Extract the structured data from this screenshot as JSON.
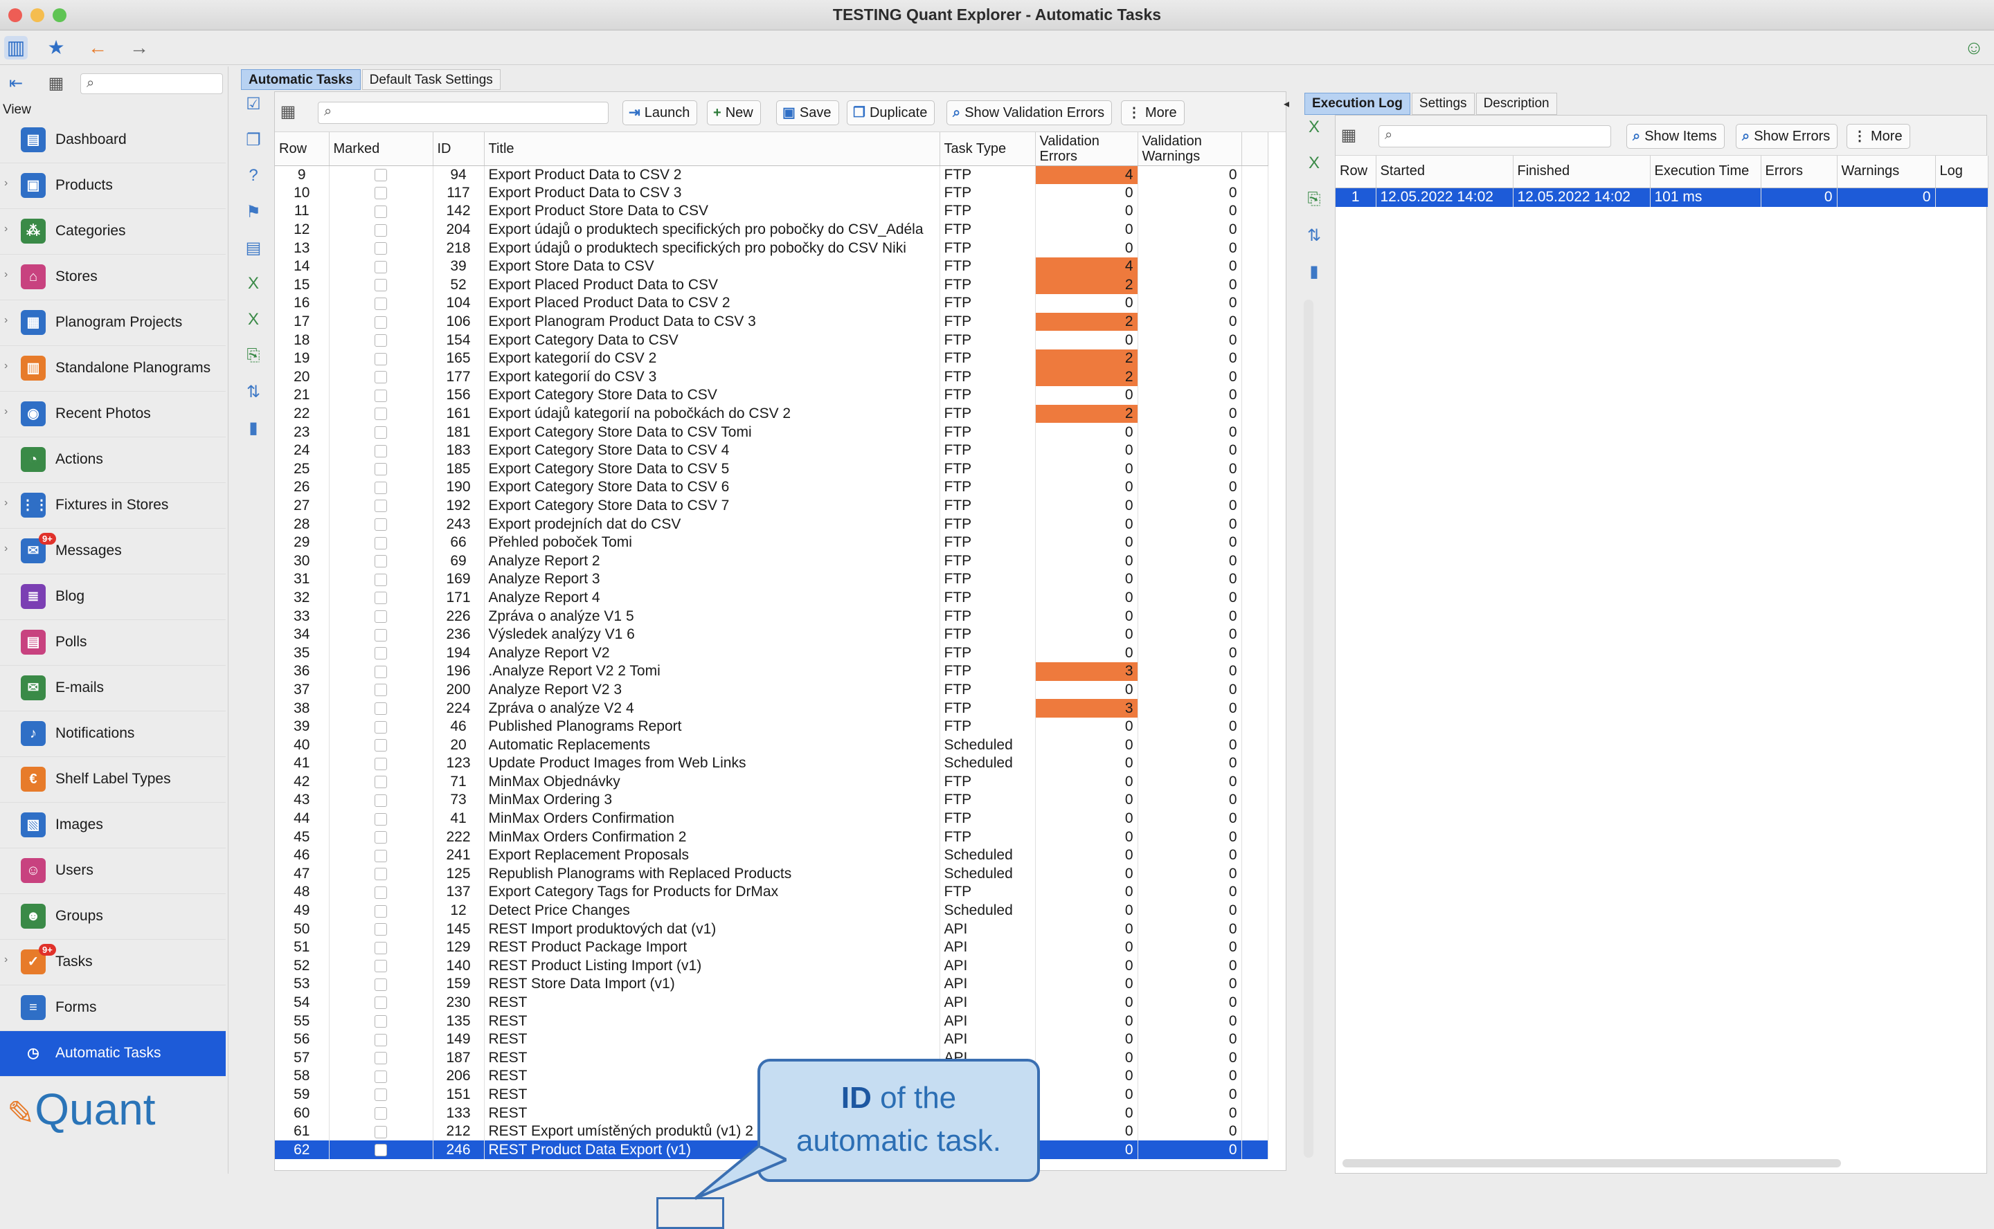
{
  "window": {
    "title": "TESTING Quant Explorer - Automatic Tasks"
  },
  "sidebar": {
    "view_label": "View",
    "items": [
      {
        "label": "Dashboard",
        "icon": "dashboard-icon",
        "color": "#2f6fc6",
        "chevron": false
      },
      {
        "label": "Products",
        "icon": "products-icon",
        "color": "#2f6fc6",
        "chevron": true
      },
      {
        "label": "Categories",
        "icon": "categories-icon",
        "color": "#3a8a47",
        "chevron": true
      },
      {
        "label": "Stores",
        "icon": "stores-icon",
        "color": "#c8427f",
        "chevron": true
      },
      {
        "label": "Planogram Projects",
        "icon": "planogram-projects-icon",
        "color": "#2f6fc6",
        "chevron": true
      },
      {
        "label": "Standalone Planograms",
        "icon": "standalone-planograms-icon",
        "color": "#e77b2a",
        "chevron": true
      },
      {
        "label": "Recent Photos",
        "icon": "camera-icon",
        "color": "#2f6fc6",
        "chevron": true
      },
      {
        "label": "Actions",
        "icon": "actions-icon",
        "color": "#3a8a47",
        "chevron": false
      },
      {
        "label": "Fixtures in Stores",
        "icon": "fixtures-icon",
        "color": "#2f6fc6",
        "chevron": true
      },
      {
        "label": "Messages",
        "icon": "messages-icon",
        "color": "#2f6fc6",
        "chevron": true,
        "badge": "9+"
      },
      {
        "label": "Blog",
        "icon": "blog-icon",
        "color": "#7b3fb3",
        "chevron": false
      },
      {
        "label": "Polls",
        "icon": "polls-icon",
        "color": "#c8427f",
        "chevron": false
      },
      {
        "label": "E-mails",
        "icon": "email-icon",
        "color": "#3a8a47",
        "chevron": false
      },
      {
        "label": "Notifications",
        "icon": "notifications-icon",
        "color": "#2f6fc6",
        "chevron": false
      },
      {
        "label": "Shelf Label Types",
        "icon": "shelf-label-icon",
        "color": "#e77b2a",
        "chevron": false
      },
      {
        "label": "Images",
        "icon": "images-icon",
        "color": "#2f6fc6",
        "chevron": false
      },
      {
        "label": "Users",
        "icon": "users-icon",
        "color": "#c8427f",
        "chevron": false
      },
      {
        "label": "Groups",
        "icon": "groups-icon",
        "color": "#3a8a47",
        "chevron": false
      },
      {
        "label": "Tasks",
        "icon": "tasks-icon",
        "color": "#e77b2a",
        "chevron": true,
        "badge": "9+"
      },
      {
        "label": "Forms",
        "icon": "forms-icon",
        "color": "#2f6fc6",
        "chevron": false
      },
      {
        "label": "Automatic Tasks",
        "icon": "automatic-tasks-icon",
        "color": "#2f6fc6",
        "chevron": false,
        "selected": true
      }
    ],
    "logo": "Quant"
  },
  "main": {
    "tabs": [
      "Automatic Tasks",
      "Default Task Settings"
    ],
    "buttons": {
      "launch": "Launch",
      "new": "New",
      "save": "Save",
      "duplicate": "Duplicate",
      "show_validation_errors": "Show Validation Errors",
      "more": "More"
    },
    "columns": [
      "Row",
      "Marked",
      "ID",
      "Title",
      "Task Type",
      "Validation Errors",
      "Validation Warnings"
    ],
    "rows": [
      [
        9,
        94,
        "Export Product Data to CSV 2",
        "FTP",
        4,
        0
      ],
      [
        10,
        117,
        "Export Product Data to CSV 3",
        "FTP",
        0,
        0
      ],
      [
        11,
        142,
        "Export Product Store Data to CSV",
        "FTP",
        0,
        0
      ],
      [
        12,
        204,
        "Export údajů o produktech specifických pro pobočky do CSV_Adéla",
        "FTP",
        0,
        0
      ],
      [
        13,
        218,
        "Export údajů o produktech specifických pro pobočky do CSV Niki",
        "FTP",
        0,
        0
      ],
      [
        14,
        39,
        "Export Store Data to CSV",
        "FTP",
        4,
        0
      ],
      [
        15,
        52,
        "Export Placed Product Data to CSV",
        "FTP",
        2,
        0
      ],
      [
        16,
        104,
        "Export Placed Product Data to CSV 2",
        "FTP",
        0,
        0
      ],
      [
        17,
        106,
        "Export Planogram Product Data to CSV 3",
        "FTP",
        2,
        0
      ],
      [
        18,
        154,
        "Export Category Data to CSV",
        "FTP",
        0,
        0
      ],
      [
        19,
        165,
        "Export kategorií do CSV 2",
        "FTP",
        2,
        0
      ],
      [
        20,
        177,
        "Export kategorií do CSV 3",
        "FTP",
        2,
        0
      ],
      [
        21,
        156,
        "Export Category Store Data to CSV",
        "FTP",
        0,
        0
      ],
      [
        22,
        161,
        "Export údajů kategorií na pobočkách do CSV 2",
        "FTP",
        2,
        0
      ],
      [
        23,
        181,
        "Export Category Store Data to CSV Tomi",
        "FTP",
        0,
        0
      ],
      [
        24,
        183,
        "Export Category Store Data to CSV 4",
        "FTP",
        0,
        0
      ],
      [
        25,
        185,
        "Export Category Store Data to CSV 5",
        "FTP",
        0,
        0
      ],
      [
        26,
        190,
        "Export Category Store Data to CSV 6",
        "FTP",
        0,
        0
      ],
      [
        27,
        192,
        "Export Category Store Data to CSV 7",
        "FTP",
        0,
        0
      ],
      [
        28,
        243,
        "Export prodejních dat do CSV",
        "FTP",
        0,
        0
      ],
      [
        29,
        66,
        "Přehled poboček Tomi",
        "FTP",
        0,
        0
      ],
      [
        30,
        69,
        "Analyze Report 2",
        "FTP",
        0,
        0
      ],
      [
        31,
        169,
        "Analyze Report 3",
        "FTP",
        0,
        0
      ],
      [
        32,
        171,
        "Analyze Report 4",
        "FTP",
        0,
        0
      ],
      [
        33,
        226,
        "Zpráva o analýze V1 5",
        "FTP",
        0,
        0
      ],
      [
        34,
        236,
        "Výsledek analýzy V1 6",
        "FTP",
        0,
        0
      ],
      [
        35,
        194,
        "Analyze Report V2",
        "FTP",
        0,
        0
      ],
      [
        36,
        196,
        ".Analyze Report V2 2 Tomi",
        "FTP",
        3,
        0
      ],
      [
        37,
        200,
        "Analyze Report V2 3",
        "FTP",
        0,
        0
      ],
      [
        38,
        224,
        "Zpráva o analýze V2 4",
        "FTP",
        3,
        0
      ],
      [
        39,
        46,
        "Published Planograms Report",
        "FTP",
        0,
        0
      ],
      [
        40,
        20,
        "Automatic Replacements",
        "Scheduled",
        0,
        0
      ],
      [
        41,
        123,
        "Update Product Images from Web Links",
        "Scheduled",
        0,
        0
      ],
      [
        42,
        71,
        "MinMax Objednávky",
        "FTP",
        0,
        0
      ],
      [
        43,
        73,
        "MinMax Ordering 3",
        "FTP",
        0,
        0
      ],
      [
        44,
        41,
        "MinMax Orders Confirmation",
        "FTP",
        0,
        0
      ],
      [
        45,
        222,
        "MinMax Orders Confirmation 2",
        "FTP",
        0,
        0
      ],
      [
        46,
        241,
        "Export Replacement Proposals",
        "Scheduled",
        0,
        0
      ],
      [
        47,
        125,
        "Republish Planograms with Replaced Products",
        "Scheduled",
        0,
        0
      ],
      [
        48,
        137,
        "Export Category Tags for Products for DrMax",
        "FTP",
        0,
        0
      ],
      [
        49,
        12,
        "Detect Price Changes",
        "Scheduled",
        0,
        0
      ],
      [
        50,
        145,
        "REST Import produktových dat (v1)",
        "API",
        0,
        0
      ],
      [
        51,
        129,
        "REST Product Package Import",
        "API",
        0,
        0
      ],
      [
        52,
        140,
        "REST Product Listing Import (v1)",
        "API",
        0,
        0
      ],
      [
        53,
        159,
        "REST Store Data Import (v1)",
        "API",
        0,
        0
      ],
      [
        54,
        230,
        "REST",
        "API",
        0,
        0
      ],
      [
        55,
        135,
        "REST",
        "API",
        0,
        0
      ],
      [
        56,
        149,
        "REST",
        "API",
        0,
        0
      ],
      [
        57,
        187,
        "REST",
        "API",
        0,
        0
      ],
      [
        58,
        206,
        "REST",
        "API",
        0,
        0
      ],
      [
        59,
        151,
        "REST",
        "API",
        0,
        0
      ],
      [
        60,
        133,
        "REST",
        "API",
        0,
        0
      ],
      [
        61,
        212,
        "REST Export umístěných produktů (v1) 2",
        "API",
        0,
        0
      ],
      [
        62,
        246,
        "REST Product Data Export (v1)",
        "API",
        0,
        0
      ]
    ],
    "selected_row": 62,
    "callout": {
      "bold": "ID",
      "rest1": " of the",
      "line2": "automatic task."
    }
  },
  "right": {
    "tabs": [
      "Execution Log",
      "Settings",
      "Description"
    ],
    "buttons": {
      "show_items": "Show Items",
      "show_errors": "Show Errors",
      "more": "More"
    },
    "columns": [
      "Row",
      "Started",
      "Finished",
      "Execution Time",
      "Errors",
      "Warnings",
      "Log"
    ],
    "rows": [
      [
        "1",
        "12.05.2022 14:02",
        "12.05.2022 14:02",
        "101 ms",
        "0",
        "0",
        ""
      ]
    ]
  },
  "colors": {
    "selection": "#1d5bd8",
    "error_cell": "#ee7a3d",
    "accent": "#2a74b8"
  }
}
